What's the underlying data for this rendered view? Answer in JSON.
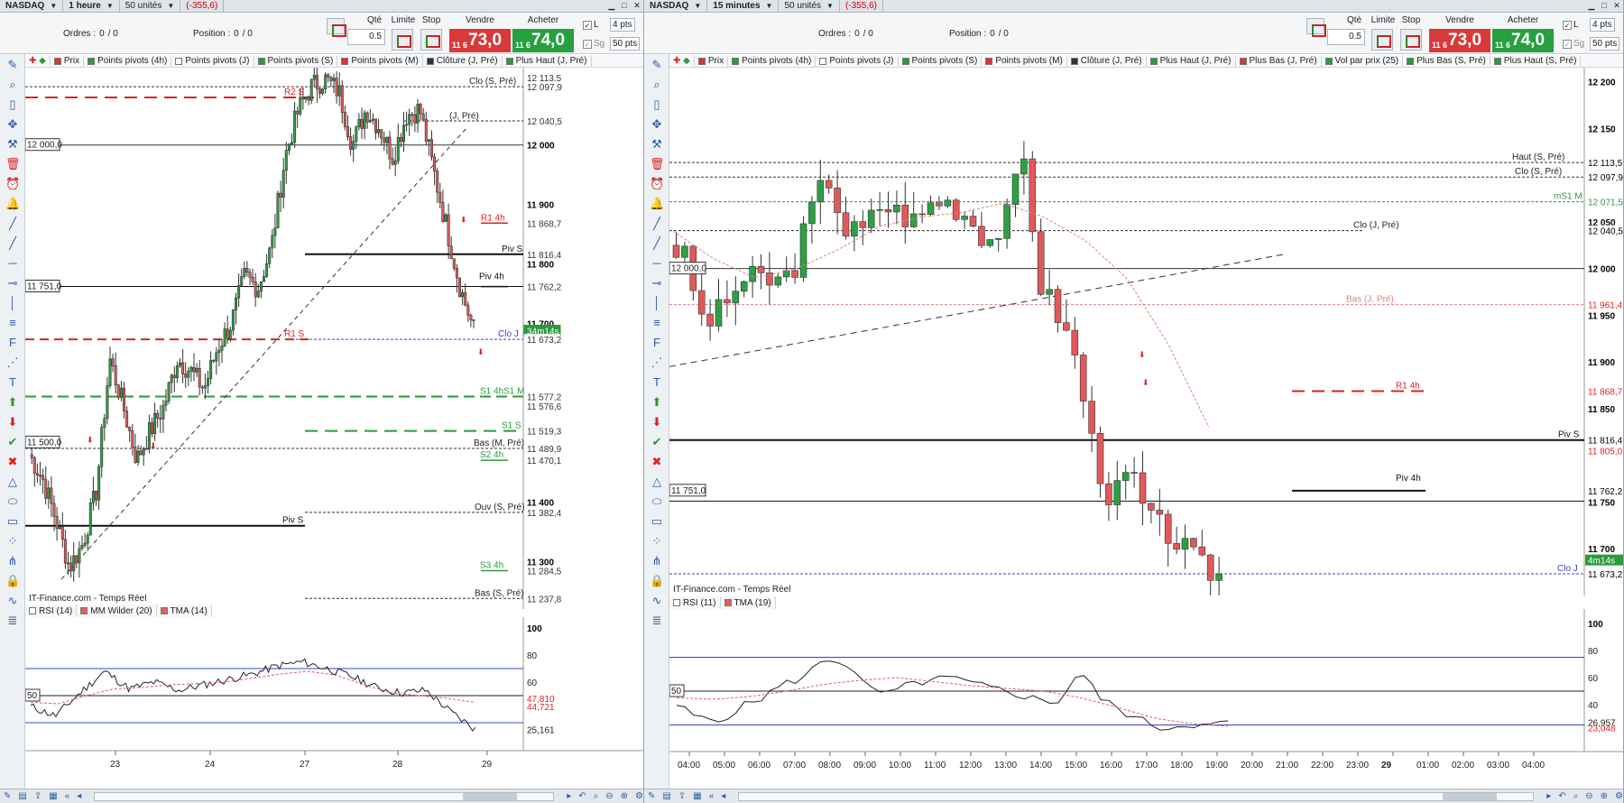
{
  "left": {
    "titlebar": {
      "instrument": "NASDAQ",
      "timeframe": "1 heure",
      "units": "50 unités",
      "variation": "(-355,6)"
    },
    "orders": {
      "orders_label": "Ordres :",
      "orders_value": "0",
      "orders_sep": "/ 0",
      "position_label": "Position :",
      "position_value": "0",
      "position_sep": "/ 0"
    },
    "trade": {
      "qty_label": "Qté",
      "qty_value": "0.5",
      "limit_label": "Limite",
      "stop_label": "Stop",
      "sell_label": "Vendre",
      "buy_label": "Acheter",
      "sell_small": "11 6",
      "sell_big": "73,0",
      "buy_small": "11 6",
      "buy_big": "74,0",
      "l_label": "L",
      "sg_label": "Sg",
      "pts1": "4",
      "pts1_unit": "pts",
      "pts2": "50",
      "pts2_unit": "pts"
    },
    "indicators": [
      "Prix",
      "Points pivots (4h)",
      "Points pivots (J)",
      "Points pivots (S)",
      "Points pivots (M)",
      "Clôture (J, Pré)",
      "Plus Haut (J, Pré)"
    ],
    "source": "IT-Finance.com - Temps Réel",
    "sub_indicators": [
      "RSI (14)",
      "MM Wilder (20)",
      "TMA (14)"
    ],
    "price_levels": [
      {
        "label": "12 113,5",
        "y": 12113.5
      },
      {
        "label": "12 097,9",
        "y": 12097.9
      },
      {
        "label": "12 040,5",
        "y": 12040.5
      },
      {
        "label": "12 000",
        "y": 12000
      },
      {
        "label": "11 900",
        "y": 11900
      },
      {
        "label": "11 868,7",
        "y": 11868.7
      },
      {
        "label": "11 816,4",
        "y": 11816.4
      },
      {
        "label": "11 800",
        "y": 11800
      },
      {
        "label": "11 762,2",
        "y": 11762.2
      },
      {
        "label": "11 700",
        "y": 11700
      },
      {
        "label": "34m14s",
        "y": 11688
      },
      {
        "label": "11 673,2",
        "y": 11673.2
      },
      {
        "label": "11 577,2",
        "y": 11577.2
      },
      {
        "label": "11 576,6",
        "y": 11561
      },
      {
        "label": "11 519,3",
        "y": 11519.3
      },
      {
        "label": "11 489,9",
        "y": 11489.9
      },
      {
        "label": "11 470,1",
        "y": 11470.1
      },
      {
        "label": "11 400",
        "y": 11400
      },
      {
        "label": "11 382,4",
        "y": 11382.4
      },
      {
        "label": "11 300",
        "y": 11300
      },
      {
        "label": "11 284,5",
        "y": 11284.5
      },
      {
        "label": "11 237,8",
        "y": 11237.8
      }
    ],
    "line_labels": [
      "Clo (S, Pré)",
      "(J, Pré)",
      "R1 4h",
      "Piv S",
      "Piv 4h",
      "Clo J",
      "R1 S",
      "S1 4hS1 M",
      "S1 S",
      "Bas (M, Pré)",
      "S2 4h",
      "Ouv (S, Pré)",
      "S3 4h",
      "Bas (S, Pré)",
      "Piv S",
      "R2 S"
    ],
    "tags": [
      "12 000,0",
      "11 751,0",
      "11 500,0",
      "50"
    ],
    "rsi_levels": [
      "100",
      "80",
      "60",
      "47,810",
      "44,721",
      "25,161"
    ],
    "dates": [
      "23",
      "24",
      "27",
      "28",
      "29"
    ]
  },
  "right": {
    "titlebar": {
      "instrument": "NASDAQ",
      "timeframe": "15 minutes",
      "units": "50 unités",
      "variation": "(-355,6)"
    },
    "orders": {
      "orders_label": "Ordres :",
      "orders_value": "0",
      "orders_sep": "/ 0",
      "position_label": "Position :",
      "position_value": "0",
      "position_sep": "/ 0"
    },
    "trade": {
      "qty_label": "Qté",
      "qty_value": "0.5",
      "limit_label": "Limite",
      "stop_label": "Stop",
      "sell_label": "Vendre",
      "buy_label": "Acheter",
      "sell_small": "11 6",
      "sell_big": "73,0",
      "buy_small": "11 6",
      "buy_big": "74,0",
      "l_label": "L",
      "sg_label": "Sg",
      "pts1": "4",
      "pts1_unit": "pts",
      "pts2": "50",
      "pts2_unit": "pts"
    },
    "indicators": [
      "Prix",
      "Points pivots (4h)",
      "Points pivots (J)",
      "Points pivots (S)",
      "Points pivots (M)",
      "Clôture (J, Pré)",
      "Plus Haut (J, Pré)",
      "Plus Bas (J, Pré)",
      "Vol par prix (25)",
      "Plus Bas (S, Pré)",
      "Plus Haut (S, Pré)"
    ],
    "source": "IT-Finance.com - Temps Réel",
    "sub_indicators": [
      "RSI (11)",
      "TMA (19)"
    ],
    "price_levels": [
      {
        "label": "12 200",
        "y": 12200
      },
      {
        "label": "12 150",
        "y": 12150
      },
      {
        "label": "12 113,5",
        "y": 12113.5
      },
      {
        "label": "12 097,9",
        "y": 12097.9
      },
      {
        "label": "12 071,5",
        "y": 12071.5
      },
      {
        "label": "12 050",
        "y": 12050
      },
      {
        "label": "12 040,5",
        "y": 12040.5
      },
      {
        "label": "12 000",
        "y": 12000
      },
      {
        "label": "11 961,4",
        "y": 11961.4
      },
      {
        "label": "11 950",
        "y": 11950
      },
      {
        "label": "11 900",
        "y": 11900
      },
      {
        "label": "11 868,7",
        "y": 11868.7
      },
      {
        "label": "11 850",
        "y": 11850
      },
      {
        "label": "11 816,4",
        "y": 11816.4
      },
      {
        "label": "11 805,0",
        "y": 11805
      },
      {
        "label": "11 762,2",
        "y": 11762.2
      },
      {
        "label": "11 750",
        "y": 11750
      },
      {
        "label": "11 700",
        "y": 11700
      },
      {
        "label": "4m14s",
        "y": 11688
      },
      {
        "label": "11 673,2",
        "y": 11673.2
      }
    ],
    "line_labels": [
      "Haut (S, Pré)",
      "Clo (S, Pré)",
      "mS1 M",
      "Clo (J, Pré)",
      "Bas (J, Pré)",
      "R1 4h",
      "Piv S",
      "Piv 4h",
      "Clo J"
    ],
    "tags": [
      "12 000,0",
      "11 751,0",
      "50"
    ],
    "rsi_levels": [
      "100",
      "80",
      "60",
      "40",
      "26,957",
      "23,048"
    ],
    "times": [
      "04:00",
      "05:00",
      "06:00",
      "07:00",
      "08:00",
      "09:00",
      "10:00",
      "11:00",
      "12:00",
      "13:00",
      "14:00",
      "15:00",
      "16:00",
      "17:00",
      "18:00",
      "19:00",
      "20:00",
      "21:00",
      "22:00",
      "23:00",
      "29",
      "01:00",
      "02:00",
      "03:00",
      "04:00"
    ]
  },
  "colors": {
    "up": "#2ea043",
    "down": "#e05a5a",
    "sell": "#d83a3a",
    "buy": "#27a040",
    "accent": "#2a5cab"
  },
  "chart_data": [
    {
      "type": "candlestick",
      "title": "NASDAQ 1 heure",
      "x_ticks": [
        "23",
        "24",
        "27",
        "28",
        "29"
      ],
      "ylim": [
        11220,
        12130
      ],
      "close_last": 11673.2
    },
    {
      "type": "candlestick",
      "title": "NASDAQ 15 minutes",
      "x_ticks": [
        "04:00",
        "05:00",
        "06:00",
        "07:00",
        "08:00",
        "09:00",
        "10:00",
        "11:00",
        "12:00",
        "13:00",
        "14:00",
        "15:00",
        "16:00",
        "17:00",
        "18:00",
        "19:00",
        "20:00",
        "21:00",
        "22:00",
        "23:00",
        "29",
        "01:00",
        "02:00",
        "03:00",
        "04:00"
      ],
      "ylim": [
        11650,
        12215
      ],
      "close_last": 11673.2
    }
  ]
}
